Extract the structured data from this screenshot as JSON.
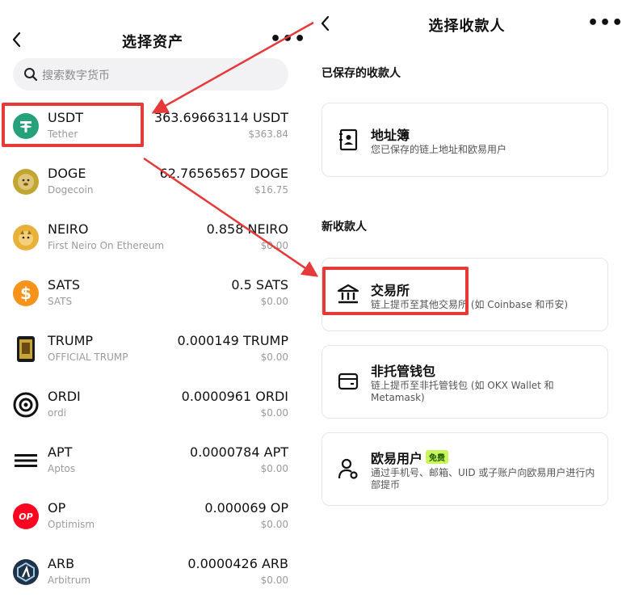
{
  "left": {
    "title": "选择资产",
    "search_placeholder": "搜索数字货币",
    "assets": [
      {
        "symbol": "USDT",
        "name": "Tether",
        "amount": "363.69663114 USDT",
        "usd": "$363.84",
        "icon": "tether-icon",
        "color": "#26a17b"
      },
      {
        "symbol": "DOGE",
        "name": "Dogecoin",
        "amount": "62.76565657 DOGE",
        "usd": "$16.75",
        "icon": "doge-icon",
        "color": "#c2a633"
      },
      {
        "symbol": "NEIRO",
        "name": "First Neiro On Ethereum",
        "amount": "0.858 NEIRO",
        "usd": "$0.00",
        "icon": "neiro-icon",
        "color": "#e8b23a"
      },
      {
        "symbol": "SATS",
        "name": "SATS",
        "amount": "0.5 SATS",
        "usd": "$0.00",
        "icon": "sats-icon",
        "color": "#f7931a"
      },
      {
        "symbol": "TRUMP",
        "name": "OFFICIAL TRUMP",
        "amount": "0.000149 TRUMP",
        "usd": "$0.00",
        "icon": "trump-icon",
        "color": "#1b1b1b"
      },
      {
        "symbol": "ORDI",
        "name": "ordi",
        "amount": "0.0000961 ORDI",
        "usd": "$0.00",
        "icon": "ordi-icon",
        "color": "#111111"
      },
      {
        "symbol": "APT",
        "name": "Aptos",
        "amount": "0.0000784 APT",
        "usd": "$0.00",
        "icon": "aptos-icon",
        "color": "#111111"
      },
      {
        "symbol": "OP",
        "name": "Optimism",
        "amount": "0.000069 OP",
        "usd": "$0.00",
        "icon": "optimism-icon",
        "color": "#ff0420"
      },
      {
        "symbol": "ARB",
        "name": "Arbitrum",
        "amount": "0.0000426 ARB",
        "usd": "$0.00",
        "icon": "arbitrum-icon",
        "color": "#213147"
      }
    ]
  },
  "right": {
    "title": "选择收款人",
    "saved_label": "已保存的收款人",
    "new_label": "新收款人",
    "address_book": {
      "title": "地址簿",
      "desc": "您已保存的链上地址和欧易用户"
    },
    "exchange": {
      "title": "交易所",
      "desc": "链上提币至其他交易所 (如 Coinbase 和币安)"
    },
    "wallet": {
      "title": "非托管钱包",
      "desc": "链上提币至非托管钱包 (如 OKX Wallet 和 Metamask)"
    },
    "okx_user": {
      "title": "欧易用户",
      "badge": "免费",
      "desc": "通过手机号、邮箱、UID 或子账户向欧易用户进行内部提币"
    }
  },
  "colors": {
    "highlight": "#e63a3a",
    "badge_bg": "#c8f55b"
  }
}
